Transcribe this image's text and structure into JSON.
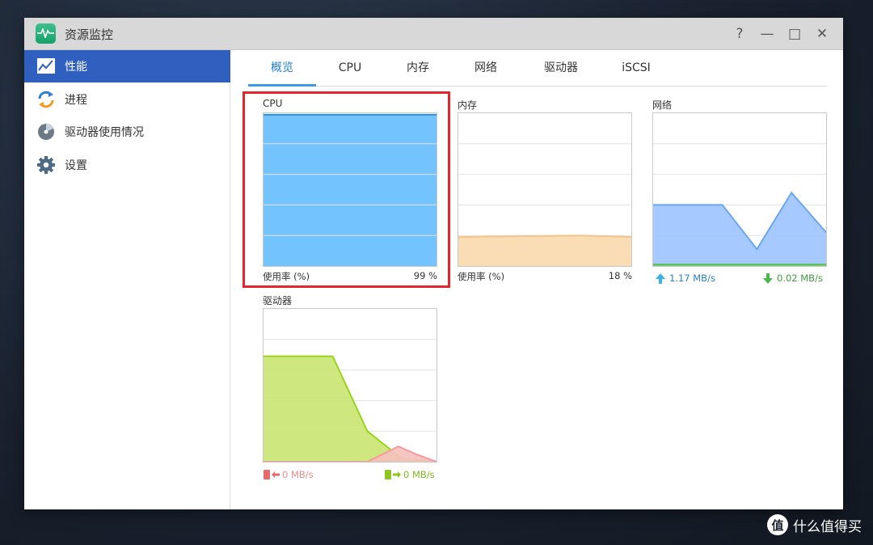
{
  "window": {
    "title": "资源监控",
    "controls": {
      "help": "?",
      "minimize": "—",
      "maximize": "□",
      "close": "✕"
    }
  },
  "sidebar": {
    "items": [
      {
        "label": "性能",
        "icon": "performance-chart-icon",
        "active": true
      },
      {
        "label": "进程",
        "icon": "process-cycle-icon",
        "active": false
      },
      {
        "label": "驱动器使用情况",
        "icon": "disk-usage-icon",
        "active": false
      },
      {
        "label": "设置",
        "icon": "gear-icon",
        "active": false
      }
    ]
  },
  "tabs": [
    {
      "label": "概览",
      "active": true
    },
    {
      "label": "CPU",
      "active": false
    },
    {
      "label": "内存",
      "active": false
    },
    {
      "label": "网络",
      "active": false
    },
    {
      "label": "驱动器",
      "active": false
    },
    {
      "label": "iSCSI",
      "active": false
    }
  ],
  "panels": {
    "cpu": {
      "title": "CPU",
      "footer_label": "使用率 (%)",
      "footer_value": "99 %"
    },
    "memory": {
      "title": "内存",
      "footer_label": "使用率 (%)",
      "footer_value": "18 %"
    },
    "network": {
      "title": "网络",
      "upload": "1.17 MB/s",
      "download": "0.02 MB/s"
    },
    "drive": {
      "title": "驱动器",
      "read": "0 MB/s",
      "write": "0 MB/s"
    }
  },
  "colors": {
    "cpu_fill": "#64bcff",
    "cpu_line": "#2b8fe6",
    "mem_fill": "#fbd9ad",
    "mem_line": "#f4c48a",
    "net_up_fill": "#9cc4ff",
    "net_up_line": "#6ba5f5",
    "net_down_line": "#57c257",
    "drive_read_fill": "#f6c0bc",
    "drive_read_line": "#f59aa0",
    "drive_write_fill": "#c9e671",
    "drive_write_line": "#9ad41a",
    "upload_arrow": "#37b3e6",
    "download_arrow": "#4bb84b",
    "read_text": "#ef8a8a",
    "write_text": "#7cbb1f"
  },
  "chart_data": [
    {
      "type": "area",
      "name_ref": "CPU",
      "ylim": [
        0,
        100
      ],
      "x": [
        0,
        10
      ],
      "values": [
        99,
        99
      ]
    },
    {
      "type": "area",
      "name_ref": "内存",
      "ylim": [
        0,
        100
      ],
      "x": [
        0,
        7,
        10
      ],
      "values": [
        19,
        20,
        19
      ]
    },
    {
      "type": "area",
      "name_ref": "网络",
      "ylim": [
        0,
        100
      ],
      "series": [
        {
          "x": [
            0,
            4,
            6,
            8,
            10
          ],
          "values": [
            40,
            40,
            11,
            48,
            22
          ]
        },
        {
          "x": [
            0,
            10
          ],
          "values": [
            1,
            1
          ]
        }
      ]
    },
    {
      "type": "area",
      "name_ref": "驱动器",
      "ylim": [
        0,
        100
      ],
      "series": [
        {
          "x": [
            0,
            4,
            6,
            8,
            10
          ],
          "values": [
            69,
            69,
            20,
            2,
            0
          ]
        },
        {
          "x": [
            0,
            6,
            7.8,
            8.8,
            10
          ],
          "values": [
            0,
            0,
            10,
            5,
            0
          ]
        }
      ]
    }
  ]
}
